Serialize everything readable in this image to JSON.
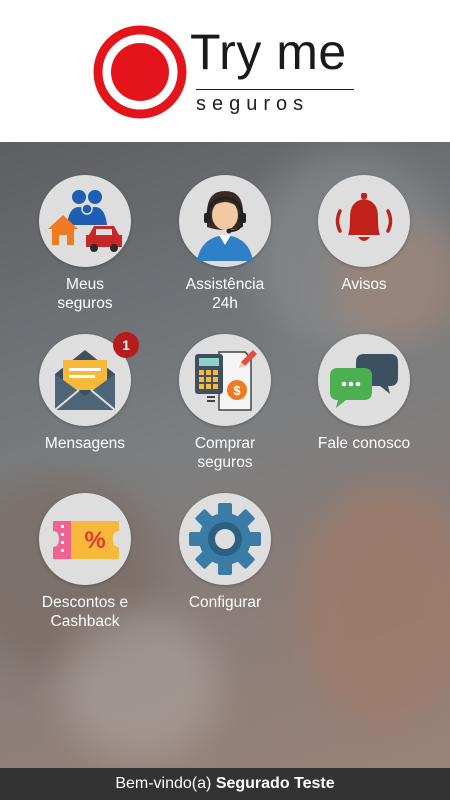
{
  "brand": {
    "title": "Try me",
    "subtitle": "seguros",
    "accent": "#e4141b"
  },
  "menu": [
    {
      "label": "Meus\nseguros",
      "icon": "family-house-car-icon"
    },
    {
      "label": "Assistência\n24h",
      "icon": "support-agent-icon"
    },
    {
      "label": "Avisos",
      "icon": "bell-icon"
    },
    {
      "label": "Mensagens",
      "icon": "envelope-icon",
      "badge": "1"
    },
    {
      "label": "Comprar\nseguros",
      "icon": "calculator-document-icon"
    },
    {
      "label": "Fale conosco",
      "icon": "chat-bubbles-icon"
    },
    {
      "label": "Descontos e\nCashback",
      "icon": "discount-ticket-icon"
    },
    {
      "label": "Configurar",
      "icon": "gear-icon"
    }
  ],
  "footer": {
    "greeting": "Bem-vindo(a)",
    "user_name": "Segurado Teste"
  }
}
